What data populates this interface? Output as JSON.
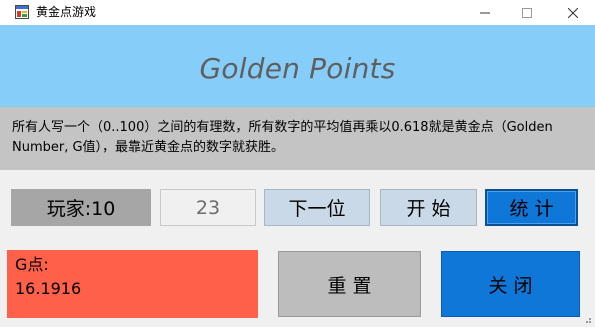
{
  "window": {
    "title": "黄金点游戏",
    "icon": "app-window-icon"
  },
  "header": {
    "title": "Golden Points",
    "background": "#87cdf9"
  },
  "rules": {
    "text": "所有人写一个（0..100）之间的有理数，所有数字的平均值再乘以0.618就是黄金点（Golden Number, G值），最靠近黄金点的数字就获胜。"
  },
  "player": {
    "label": "玩家:10"
  },
  "number_input": {
    "value": "23"
  },
  "buttons": {
    "next": "下一位",
    "start": "开 始",
    "stats": "统 计",
    "reset": "重 置",
    "close": "关 闭"
  },
  "g_point": {
    "label": "G点:",
    "value": "16.1916"
  },
  "colors": {
    "accent_blue": "#0f77d8",
    "result_panel": "#fe604a",
    "rules_band": "#c4c4c4"
  }
}
